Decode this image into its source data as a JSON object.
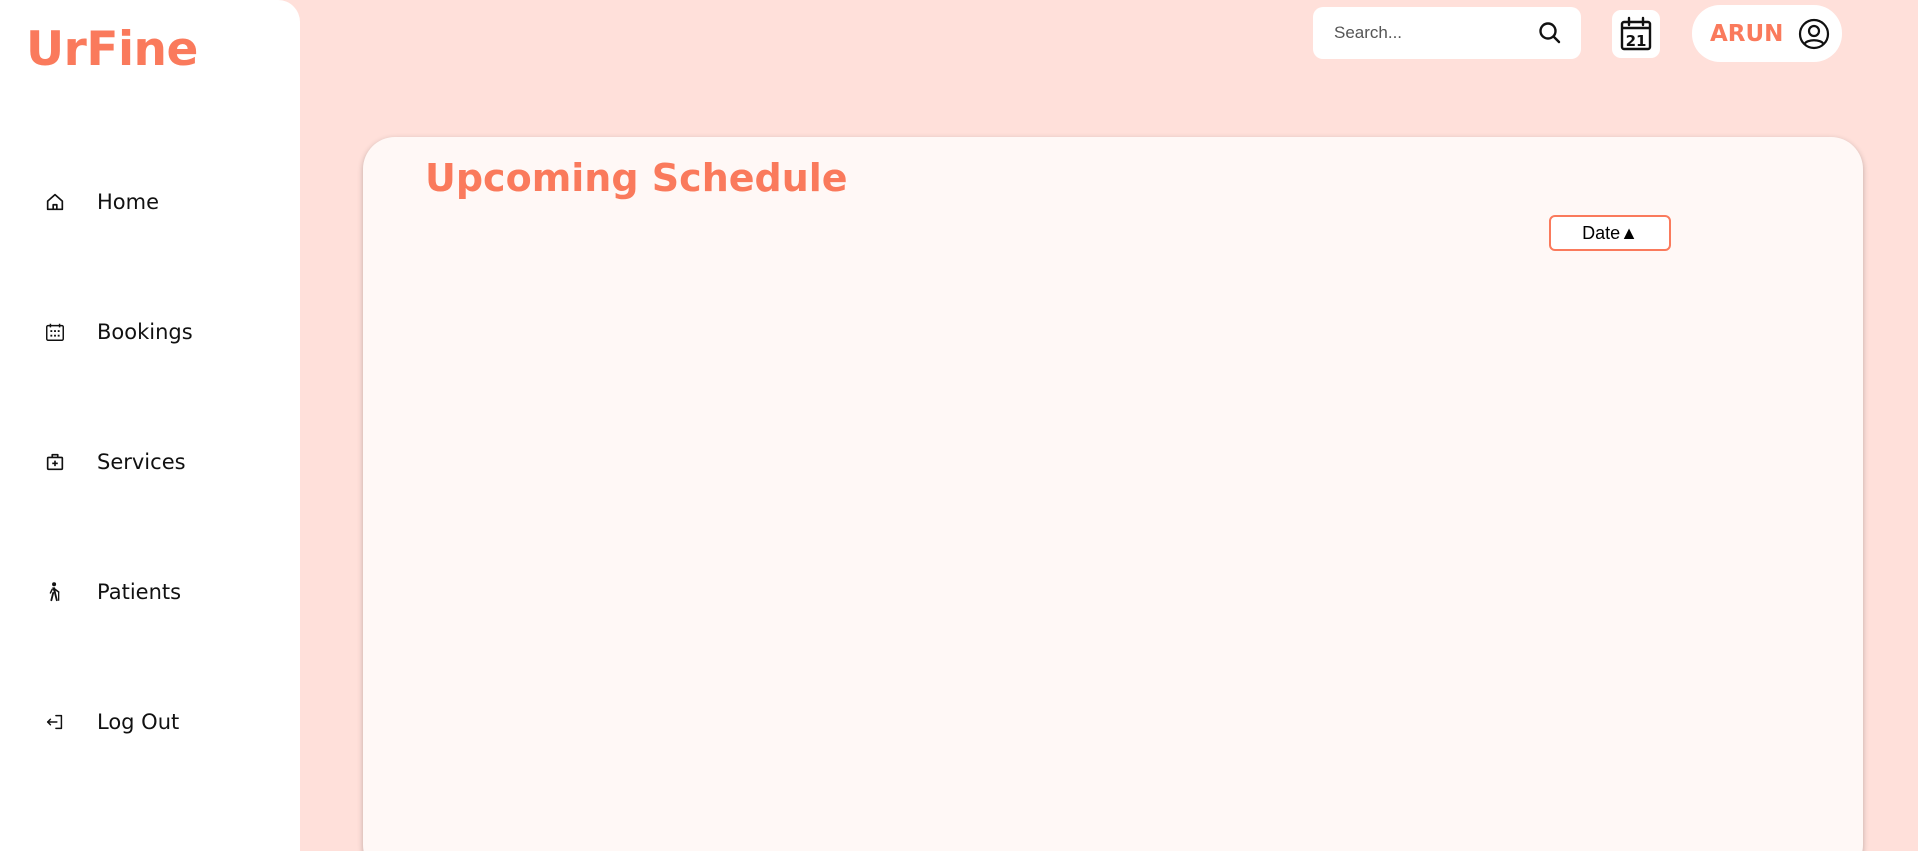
{
  "app": {
    "logo": "UrFine",
    "brand_color": "#fa7a5c",
    "background_color": "#ffe0da"
  },
  "sidebar": {
    "items": [
      {
        "label": "Home",
        "icon": "home-icon"
      },
      {
        "label": "Bookings",
        "icon": "calendar-grid-icon"
      },
      {
        "label": "Services",
        "icon": "medical-bag-icon"
      },
      {
        "label": "Patients",
        "icon": "person-with-cane-icon"
      },
      {
        "label": "Log Out",
        "icon": "logout-icon"
      }
    ]
  },
  "header": {
    "search": {
      "placeholder": "Search...",
      "value": "",
      "icon": "search-icon"
    },
    "calendar": {
      "icon": "calendar-icon",
      "day": "21"
    },
    "user": {
      "name": "ARUN",
      "icon": "user-circle-icon"
    }
  },
  "main": {
    "title": "Upcoming Schedule",
    "sort_button": {
      "label": "Date▲"
    }
  }
}
